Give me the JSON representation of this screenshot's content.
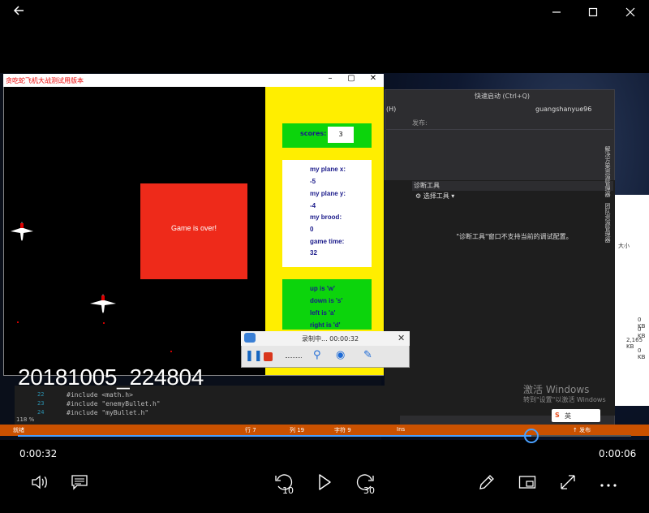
{
  "topbar": {
    "back_icon": "arrow-left-icon",
    "minimize_icon": "minimize-icon",
    "maximize_icon": "maximize-icon",
    "close_icon": "close-icon"
  },
  "game_window": {
    "title": "贪吃蛇飞机大战测试用版本",
    "game_over_text": "Game is over!",
    "score_label": "scores:",
    "score_value": "3",
    "info": [
      "my plane x:",
      "-5",
      "my plane y:",
      "-4",
      "my brood:",
      "0",
      "game time:",
      "32"
    ],
    "keys": [
      "up is 'w'",
      "down is 's'",
      "left is 'a'",
      "right is 'd'"
    ]
  },
  "ide": {
    "search_placeholder": "快速启动 (Ctrl+Q)",
    "user": "guangshanyue96",
    "menu_h": "(H)",
    "publish": "发布:",
    "diag_title": "诊断工具",
    "diag_select": "选择工具",
    "diag_message": "\"诊断工具\"窗口不支持当前的调试配置。",
    "side_tabs": [
      "解决方案资源管理器",
      "团队资源管理器"
    ],
    "code_lines": [
      {
        "num": "22",
        "text": "#include <math.h>"
      },
      {
        "num": "23",
        "text": "#include \"enemyBullet.h\""
      },
      {
        "num": "24",
        "text": "#include \"myBullet.h\""
      }
    ],
    "zoom": "118 %",
    "status": {
      "ready": "就绪",
      "row": "行 7",
      "col": "列 19",
      "char": "字符 9",
      "ins": "Ins",
      "publish": "↑ 发布"
    }
  },
  "explorer": {
    "size_label": "大小",
    "sizes": [
      "0 KB",
      "0 KB",
      "2,165 KB",
      "0 KB"
    ]
  },
  "recorder": {
    "title": "录制中... 00:00:32"
  },
  "windows_watermark": {
    "line1": "激活 Windows",
    "line2": "转到\"设置\"以激活 Windows"
  },
  "ime": {
    "label": "英"
  },
  "video": {
    "title": "20181005_224804",
    "elapsed": "0:00:32",
    "remaining": "0:00:06",
    "progress": 0.837
  },
  "controls": {
    "volume_icon": "volume-icon",
    "subtitles_icon": "subtitles-icon",
    "rewind_seconds": "10",
    "forward_seconds": "30",
    "play_icon": "play-icon",
    "edit_icon": "pencil-icon",
    "miniview_icon": "mini-view-icon",
    "fullscreen_icon": "fullscreen-icon",
    "more_icon": "more-icon"
  }
}
